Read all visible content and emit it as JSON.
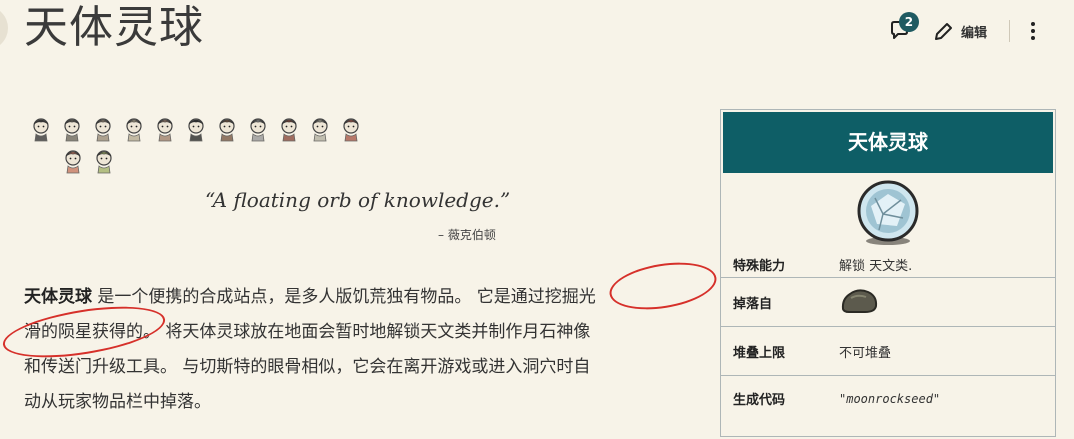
{
  "page": {
    "title": "天体灵球"
  },
  "header": {
    "talk_count": "2",
    "edit_label": "编辑"
  },
  "characters": {
    "row1": [
      "wilson",
      "willow",
      "wolfgang",
      "wendy",
      "wx78",
      "wickerbottom",
      "woodie",
      "wes",
      "maxwell",
      "wigfrid",
      "webber"
    ],
    "row2": [
      "winona",
      "wortox"
    ]
  },
  "quote": {
    "text": "“A floating orb of knowledge.”",
    "attribution": "– 薇克伯顿"
  },
  "intro": {
    "subject": "天体灵球",
    "line1": " 是一个便携的合成站点，是多人版饥荒独有物品。 它是通过挖掘光",
    "line2": "滑的陨星获得的。 将天体灵球放在地面会暂时地解锁天文类并制作月石神像",
    "line3": "和传送门升级工具。 与切斯特的眼骨相似，它会在离开游戏或进入洞穴时自",
    "line4": "动从玩家物品栏中掉落。"
  },
  "infobox": {
    "title": "天体灵球",
    "rows": [
      {
        "label": "特殊能力",
        "value": "解锁 天文类."
      },
      {
        "label": "掉落自",
        "value": ""
      },
      {
        "label": "堆叠上限",
        "value": "不可堆叠"
      },
      {
        "label": "生成代码",
        "value": "\"moonrockseed\""
      }
    ]
  },
  "colors": {
    "infobox_header": "#0e5e66",
    "badge": "#1f5a61",
    "annotation": "#d6302a",
    "background": "#f7f3e8"
  }
}
